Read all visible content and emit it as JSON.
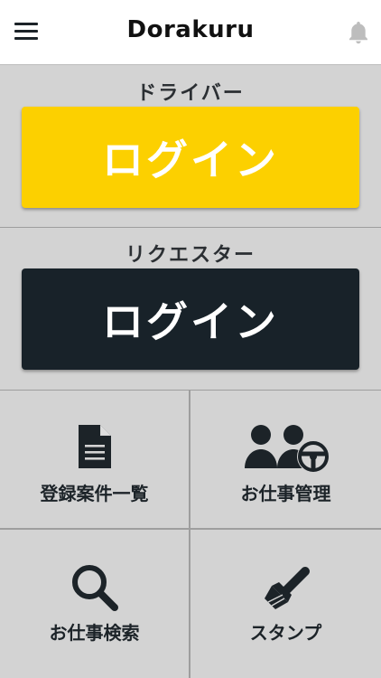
{
  "header": {
    "title": "Dorakuru",
    "menu_icon": "hamburger-menu-icon",
    "notification_icon": "bell-icon"
  },
  "driver": {
    "label": "ドライバー",
    "login_label": "ログイン",
    "button_color": "#fcd000"
  },
  "requester": {
    "label": "リクエスター",
    "login_label": "ログイン",
    "button_color": "#182229"
  },
  "tiles": [
    {
      "label": "登録案件一覧",
      "icon": "document-icon"
    },
    {
      "label": "お仕事管理",
      "icon": "people-steering-wheel-icon"
    },
    {
      "label": "お仕事検索",
      "icon": "magnifier-icon"
    },
    {
      "label": "スタンプ",
      "icon": "stamp-icon"
    }
  ],
  "colors": {
    "panel_background": "#d3d3d3",
    "icon_color": "#1c2328",
    "divider": "#9e9e9e"
  }
}
